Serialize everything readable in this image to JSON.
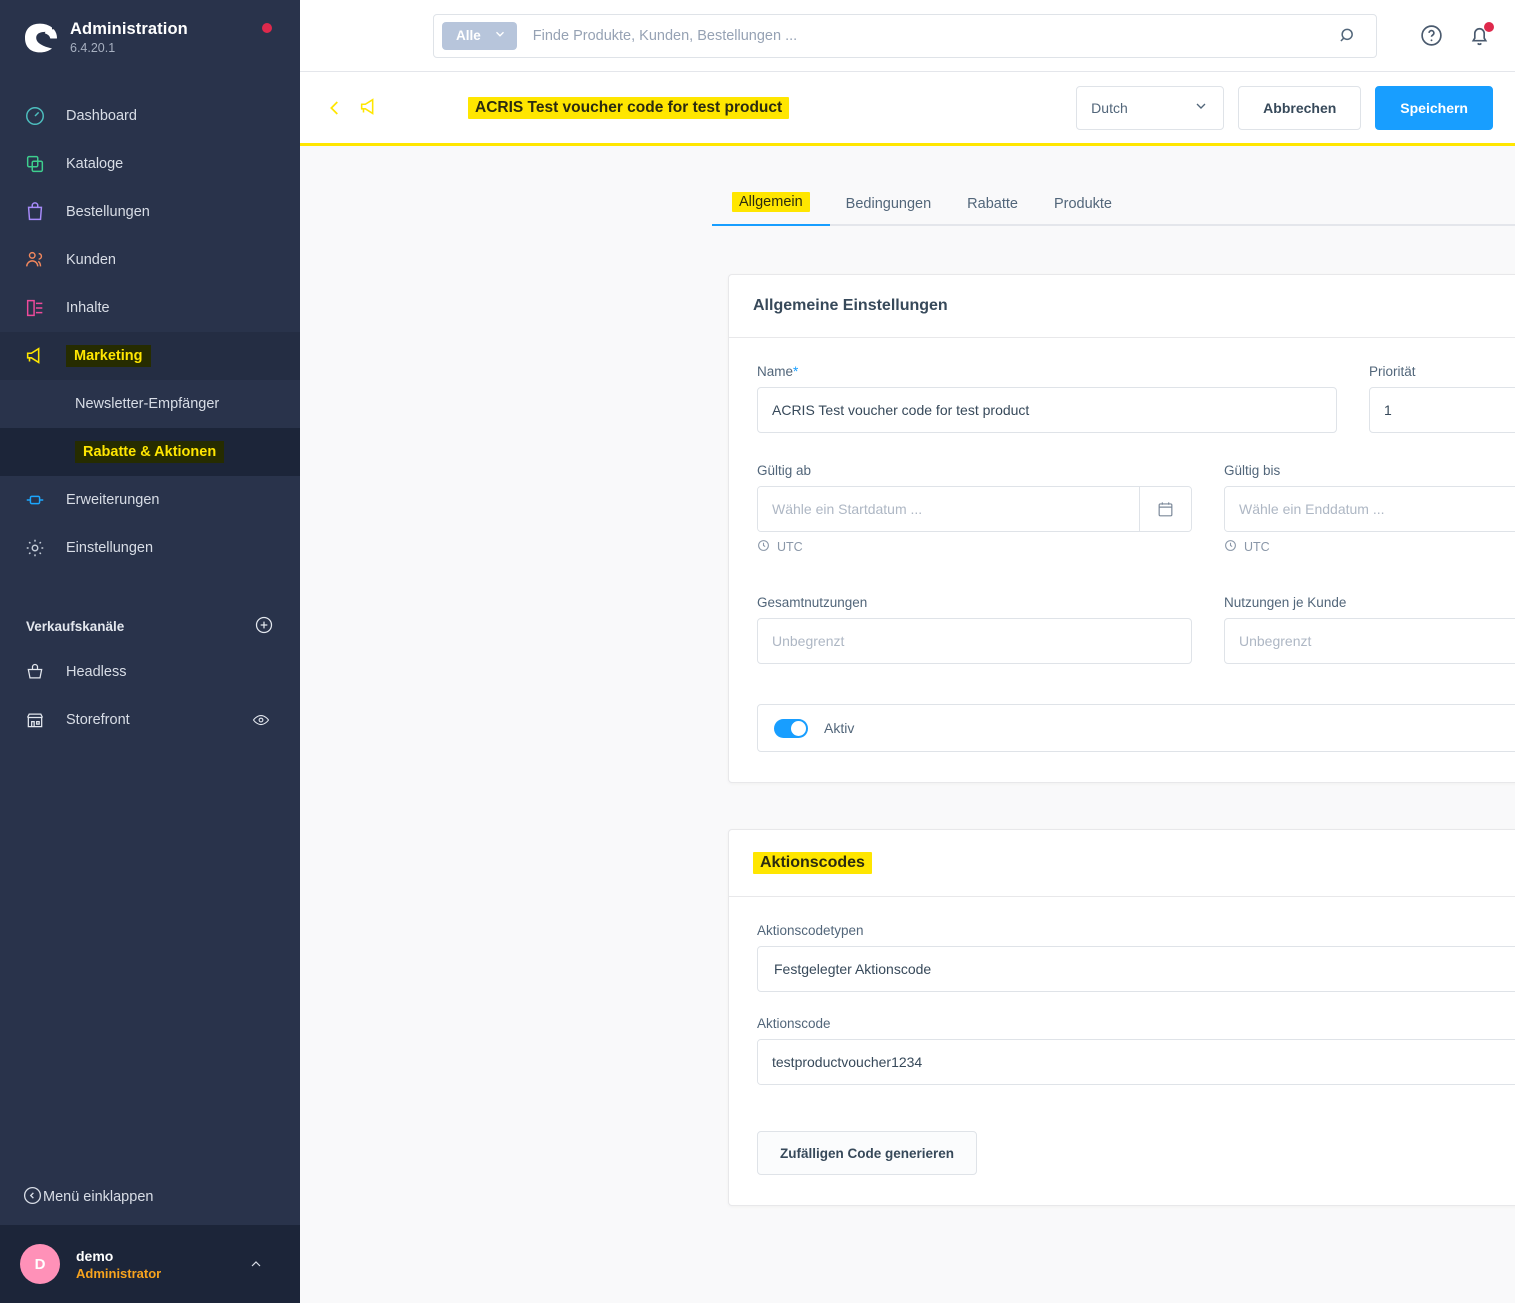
{
  "sidebar": {
    "brand": {
      "title": "Administration",
      "version": "6.4.20.1",
      "logo_icon": "shopware-logo-icon",
      "status_dot": "notification-dot"
    },
    "items": [
      {
        "label": "Dashboard",
        "icon": "dashboard-icon",
        "color": "#4dbfbf"
      },
      {
        "label": "Kataloge",
        "icon": "catalog-icon",
        "color": "#3ecf8e"
      },
      {
        "label": "Bestellungen",
        "icon": "orders-bag-icon",
        "color": "#a78bfa"
      },
      {
        "label": "Kunden",
        "icon": "customers-icon",
        "color": "#f0875d"
      },
      {
        "label": "Inhalte",
        "icon": "content-icon",
        "color": "#ef4a9b"
      },
      {
        "label": "Marketing",
        "icon": "megaphone-icon",
        "color": "#ffe600",
        "highlighted": true
      },
      {
        "label": "Erweiterungen",
        "icon": "plug-icon",
        "color": "#1ba7ff"
      },
      {
        "label": "Einstellungen",
        "icon": "gear-icon",
        "color": "#c4ccd8"
      }
    ],
    "sub_items": [
      {
        "label": "Newsletter-Empfänger",
        "highlighted": false
      },
      {
        "label": "Rabatte & Aktionen",
        "highlighted": true,
        "selected": true
      }
    ],
    "sales_channels": {
      "title": "Verkaufskanäle",
      "add_icon": "plus-circle-icon",
      "channels": [
        {
          "label": "Headless",
          "icon": "basket-icon"
        },
        {
          "label": "Storefront",
          "icon": "storefront-icon",
          "trailing_icon": "eye-icon"
        }
      ]
    },
    "collapse": {
      "label": "Menü einklappen",
      "icon": "collapse-left-icon"
    },
    "user": {
      "initial": "D",
      "name": "demo",
      "role": "Administrator",
      "caret_icon": "chevron-up-icon"
    }
  },
  "topbar": {
    "search": {
      "scope_label": "Alle",
      "scope_caret_icon": "chevron-down-icon",
      "placeholder": "Finde Produkte, Kunden, Bestellungen ...",
      "value": "",
      "search_icon": "search-icon"
    },
    "help_icon": "question-circle-icon",
    "notifications_icon": "bell-icon"
  },
  "page_header": {
    "back_icon": "chevron-left-icon",
    "module_icon": "megaphone-icon",
    "title": "ACRIS Test voucher code for test product",
    "language": {
      "value": "Dutch",
      "caret_icon": "chevron-down-icon"
    },
    "cancel_label": "Abbrechen",
    "save_label": "Speichern"
  },
  "tabs": [
    {
      "label": "Allgemein",
      "active": true,
      "highlighted": true
    },
    {
      "label": "Bedingungen",
      "active": false
    },
    {
      "label": "Rabatte",
      "active": false
    },
    {
      "label": "Produkte",
      "active": false
    }
  ],
  "general_card": {
    "title": "Allgemeine Einstellungen",
    "name": {
      "label": "Name",
      "required_marker": "*",
      "value": "ACRIS Test voucher code for test product"
    },
    "priority": {
      "label": "Priorität",
      "value": "1"
    },
    "valid_from": {
      "label": "Gültig ab",
      "placeholder": "Wähle ein Startdatum ...",
      "value": "",
      "calendar_icon": "calendar-icon",
      "timezone": "UTC",
      "clock_icon": "clock-icon"
    },
    "valid_to": {
      "label": "Gültig bis",
      "placeholder": "Wähle ein Enddatum ...",
      "value": "",
      "calendar_icon": "calendar-icon",
      "timezone": "UTC",
      "clock_icon": "clock-icon"
    },
    "total_uses": {
      "label": "Gesamtnutzungen",
      "placeholder": "Unbegrenzt",
      "value": ""
    },
    "uses_per_customer": {
      "label": "Nutzungen je Kunde",
      "placeholder": "Unbegrenzt",
      "value": ""
    },
    "active_toggle": {
      "label": "Aktiv",
      "on": true
    }
  },
  "promotion_codes_card": {
    "title": "Aktionscodes",
    "code_type": {
      "label": "Aktionscodetypen",
      "value": "Festgelegter Aktionscode",
      "caret_icon": "chevron-down-icon"
    },
    "code": {
      "label": "Aktionscode",
      "value": "testproductvoucher1234",
      "copy_icon": "copy-icon"
    },
    "generate_label": "Zufälligen Code generieren"
  },
  "colors": {
    "sidebar_bg": "#29334b",
    "highlight_yellow": "#ffe600",
    "accent_blue": "#189eff",
    "text_dark": "#37495a"
  }
}
